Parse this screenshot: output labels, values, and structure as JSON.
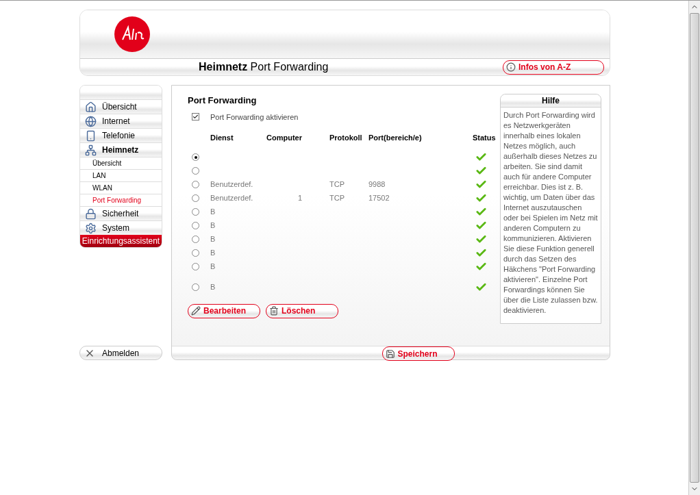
{
  "header": {
    "section": "Heimnetz",
    "page": "Port Forwarding",
    "info_button": "Infos von A-Z"
  },
  "nav": [
    {
      "kind": "main",
      "label": "Übersicht",
      "selected": false
    },
    {
      "kind": "main",
      "label": "Internet",
      "selected": false
    },
    {
      "kind": "main",
      "label": "Telefonie",
      "selected": false
    },
    {
      "kind": "main",
      "label": "Heimnetz",
      "selected": true
    },
    {
      "kind": "sub",
      "label": "Übersicht",
      "selected": false
    },
    {
      "kind": "sub",
      "label": "LAN",
      "selected": false
    },
    {
      "kind": "sub",
      "label": "WLAN",
      "selected": false
    },
    {
      "kind": "sub",
      "label": "Port Forwarding",
      "selected": true
    },
    {
      "kind": "main",
      "label": "Sicherheit",
      "selected": false
    },
    {
      "kind": "main",
      "label": "System",
      "selected": false
    }
  ],
  "wizard_button": "Einrichtungsassistent",
  "logout_button": "Abmelden",
  "main": {
    "title": "Port Forwarding",
    "enable": {
      "label": "Port Forwarding aktivieren",
      "checked": true
    },
    "columns": [
      "Dienst",
      "Computer",
      "Protokoll",
      "Port(bereich/e)",
      "Status"
    ],
    "rows": [
      {
        "selected": true,
        "status": true
      },
      {
        "selected": false,
        "status": true
      },
      {
        "selected": false,
        "dienst": "Benutzerdef.",
        "protokoll": "TCP",
        "port": "9988",
        "status": true
      },
      {
        "selected": false,
        "dienst": "Benutzerdef.",
        "computer": "1",
        "protokoll": "TCP",
        "port": "17502",
        "status": true
      },
      {
        "selected": false,
        "dienst": "B",
        "status": true
      },
      {
        "selected": false,
        "dienst": "B",
        "status": true
      },
      {
        "selected": false,
        "dienst": "B",
        "status": true
      },
      {
        "selected": false,
        "dienst": "B",
        "status": true
      },
      {
        "selected": false,
        "dienst": "B",
        "status": true
      },
      {
        "selected": false,
        "dienst": "B",
        "status": true
      }
    ],
    "buttons": [
      "Bearbeiten",
      "Löschen"
    ],
    "save_button": "Speichern"
  },
  "help": {
    "title": "Hilfe",
    "text": "Durch Port Forwarding wird es Netzwerkgeräten innerhalb eines lokalen Netzes möglich, auch außerhalb dieses Netzes zu arbeiten. Sie sind damit auch für andere Computer erreichbar. Dies ist z. B. wichtig, um Daten über das Internet auszutauschen oder bei Spielen im Netz mit anderen Computern zu kommunizieren. Aktivieren Sie diese Funktion generell durch das Setzen des Häkchens \"Port Forwarding aktivieren\". Einzelne Port Forwardings können Sie über die Liste zulassen bzw. deaktivieren."
  }
}
